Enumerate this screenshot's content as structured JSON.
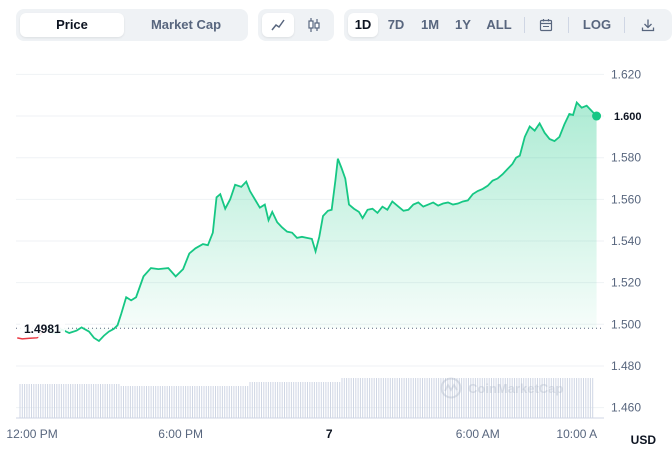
{
  "toolbar": {
    "price_label": "Price",
    "market_cap_label": "Market Cap",
    "ranges": [
      "1D",
      "7D",
      "1M",
      "1Y",
      "ALL"
    ],
    "active_range": "1D",
    "log_label": "LOG"
  },
  "price_tag": "1.600",
  "ref_tag": "1.4981",
  "currency": "USD",
  "watermark": "CoinMarketCap",
  "colors": {
    "up": "#16c784",
    "down": "#ea3943",
    "grid": "#eff2f5",
    "text": "#58667e"
  },
  "chart_data": {
    "type": "area",
    "y_ticks": [
      "1.620",
      "1.600",
      "1.580",
      "1.560",
      "1.540",
      "1.520",
      "1.500",
      "1.480",
      "1.460"
    ],
    "ylim": [
      1.455,
      1.625
    ],
    "x_ticks": [
      {
        "label": "12:00 PM",
        "x": 1,
        "bold": false
      },
      {
        "label": "6:00 PM",
        "x": 7,
        "bold": false
      },
      {
        "label": "7",
        "x": 13,
        "bold": true
      },
      {
        "label": "6:00 AM",
        "x": 19,
        "bold": false
      },
      {
        "label": "10:00 A",
        "x": 23,
        "bold": false
      }
    ],
    "xlim": [
      0.35,
      24.1
    ],
    "reference_value": 1.4981,
    "series": [
      {
        "values": [
          [
            0.4,
            1.4935
          ],
          [
            0.6,
            1.493
          ],
          [
            0.9,
            1.4933
          ],
          [
            1.2,
            1.4935
          ],
          [
            1.4,
            1.496
          ],
          [
            1.6,
            1.499
          ],
          [
            1.8,
            1.4962
          ],
          [
            2.0,
            1.4955
          ],
          [
            2.2,
            1.4975
          ],
          [
            2.5,
            1.4958
          ],
          [
            2.8,
            1.497
          ],
          [
            3.0,
            1.4985
          ],
          [
            3.3,
            1.4965
          ],
          [
            3.5,
            1.4935
          ],
          [
            3.7,
            1.492
          ],
          [
            3.9,
            1.4945
          ],
          [
            4.1,
            1.4965
          ],
          [
            4.3,
            1.4978
          ],
          [
            4.45,
            1.4995
          ],
          [
            4.6,
            1.505
          ],
          [
            4.8,
            1.513
          ],
          [
            5.0,
            1.5115
          ],
          [
            5.2,
            1.513
          ],
          [
            5.5,
            1.523
          ],
          [
            5.8,
            1.527
          ],
          [
            6.1,
            1.5265
          ],
          [
            6.5,
            1.527
          ],
          [
            6.8,
            1.523
          ],
          [
            7.1,
            1.5265
          ],
          [
            7.35,
            1.534
          ],
          [
            7.6,
            1.5365
          ],
          [
            7.9,
            1.5385
          ],
          [
            8.1,
            1.538
          ],
          [
            8.3,
            1.544
          ],
          [
            8.45,
            1.561
          ],
          [
            8.6,
            1.5625
          ],
          [
            8.8,
            1.5555
          ],
          [
            9.0,
            1.56
          ],
          [
            9.2,
            1.567
          ],
          [
            9.45,
            1.566
          ],
          [
            9.65,
            1.5685
          ],
          [
            9.8,
            1.564
          ],
          [
            10.0,
            1.56
          ],
          [
            10.2,
            1.556
          ],
          [
            10.4,
            1.5575
          ],
          [
            10.55,
            1.55
          ],
          [
            10.7,
            1.554
          ],
          [
            10.9,
            1.549
          ],
          [
            11.1,
            1.5465
          ],
          [
            11.3,
            1.5445
          ],
          [
            11.5,
            1.544
          ],
          [
            11.7,
            1.5415
          ],
          [
            11.9,
            1.542
          ],
          [
            12.1,
            1.5415
          ],
          [
            12.3,
            1.541
          ],
          [
            12.45,
            1.535
          ],
          [
            12.6,
            1.542
          ],
          [
            12.75,
            1.552
          ],
          [
            12.95,
            1.5545
          ],
          [
            13.1,
            1.555
          ],
          [
            13.25,
            1.569
          ],
          [
            13.35,
            1.5795
          ],
          [
            13.5,
            1.575
          ],
          [
            13.65,
            1.57
          ],
          [
            13.8,
            1.5575
          ],
          [
            14.0,
            1.5555
          ],
          [
            14.2,
            1.554
          ],
          [
            14.35,
            1.551
          ],
          [
            14.55,
            1.555
          ],
          [
            14.75,
            1.5555
          ],
          [
            14.95,
            1.5535
          ],
          [
            15.15,
            1.5565
          ],
          [
            15.35,
            1.555
          ],
          [
            15.55,
            1.559
          ],
          [
            15.8,
            1.5565
          ],
          [
            16.0,
            1.5545
          ],
          [
            16.2,
            1.555
          ],
          [
            16.4,
            1.5575
          ],
          [
            16.6,
            1.5585
          ],
          [
            16.8,
            1.5565
          ],
          [
            17.0,
            1.5575
          ],
          [
            17.2,
            1.5585
          ],
          [
            17.4,
            1.557
          ],
          [
            17.6,
            1.558
          ],
          [
            17.8,
            1.5585
          ],
          [
            18.0,
            1.5575
          ],
          [
            18.2,
            1.558
          ],
          [
            18.4,
            1.559
          ],
          [
            18.6,
            1.5595
          ],
          [
            18.8,
            1.5625
          ],
          [
            19.0,
            1.564
          ],
          [
            19.2,
            1.565
          ],
          [
            19.4,
            1.5665
          ],
          [
            19.6,
            1.569
          ],
          [
            19.8,
            1.57
          ],
          [
            20.0,
            1.572
          ],
          [
            20.2,
            1.5745
          ],
          [
            20.4,
            1.577
          ],
          [
            20.55,
            1.58
          ],
          [
            20.7,
            1.581
          ],
          [
            20.9,
            1.59
          ],
          [
            21.1,
            1.595
          ],
          [
            21.3,
            1.593
          ],
          [
            21.5,
            1.5965
          ],
          [
            21.7,
            1.592
          ],
          [
            21.9,
            1.589
          ],
          [
            22.1,
            1.588
          ],
          [
            22.3,
            1.59
          ],
          [
            22.5,
            1.596
          ],
          [
            22.7,
            1.601
          ],
          [
            22.85,
            1.6005
          ],
          [
            23.0,
            1.6065
          ],
          [
            23.2,
            1.604
          ],
          [
            23.4,
            1.605
          ],
          [
            23.6,
            1.6025
          ],
          [
            23.8,
            1.6
          ]
        ]
      }
    ]
  }
}
